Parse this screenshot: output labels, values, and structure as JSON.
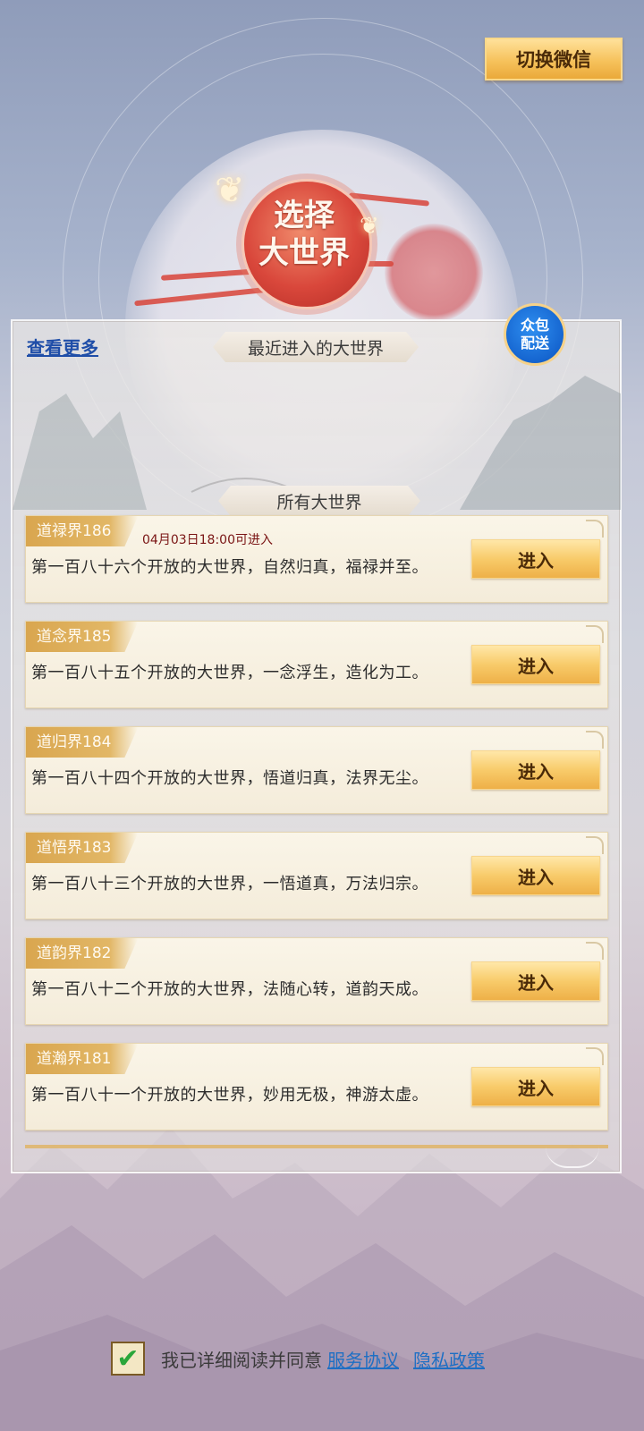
{
  "header": {
    "switch_button": "切换微信"
  },
  "emblem": {
    "line1": "选择",
    "line2": "大世界"
  },
  "panel": {
    "see_more": "查看更多",
    "recent_title": "最近进入的大世界",
    "all_title": "所有大世界",
    "crowd_badge_line1": "众包",
    "crowd_badge_line2": "配送"
  },
  "worlds": [
    {
      "name": "道禄界186",
      "time": "04月03日18:00可进入",
      "desc": "第一百八十六个开放的大世界，自然归真，福禄并至。",
      "button": "进入"
    },
    {
      "name": "道念界185",
      "time": "",
      "desc": "第一百八十五个开放的大世界，一念浮生，造化为工。",
      "button": "进入"
    },
    {
      "name": "道归界184",
      "time": "",
      "desc": "第一百八十四个开放的大世界，悟道归真，法界无尘。",
      "button": "进入"
    },
    {
      "name": "道悟界183",
      "time": "",
      "desc": "第一百八十三个开放的大世界，一悟道真，万法归宗。",
      "button": "进入"
    },
    {
      "name": "道韵界182",
      "time": "",
      "desc": "第一百八十二个开放的大世界，法随心转，道韵天成。",
      "button": "进入"
    },
    {
      "name": "道瀚界181",
      "time": "",
      "desc": "第一百八十一个开放的大世界，妙用无极，神游太虚。",
      "button": "进入"
    }
  ],
  "agreement": {
    "checked": true,
    "text": "我已详细阅读并同意",
    "service_link": "服务协议",
    "privacy_link": "隐私政策"
  },
  "colors": {
    "accent_gold": "#f6c25c",
    "link_blue": "#1e6fc4",
    "badge_blue": "#1565d0",
    "seal_red": "#d9473b"
  }
}
